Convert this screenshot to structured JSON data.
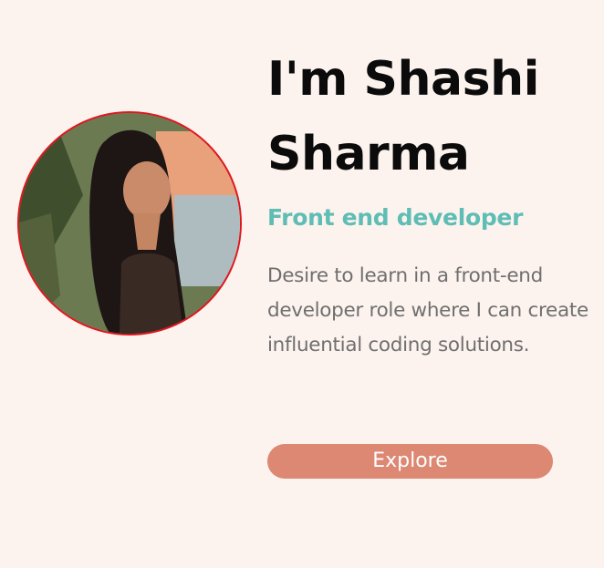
{
  "hero": {
    "title_line1": "I'm Shashi",
    "title_line2": "Sharma",
    "role": "Front end developer",
    "description": "Desire to learn in a front-end developer role where I can create influential coding solutions.",
    "button_label": "Explore"
  },
  "colors": {
    "background": "#fdf3ee",
    "role_accent": "#5ebdb4",
    "button": "#dc8873",
    "avatar_border": "#e0161e",
    "heading": "#0b0b0b",
    "body_text": "#6f6f6f"
  }
}
